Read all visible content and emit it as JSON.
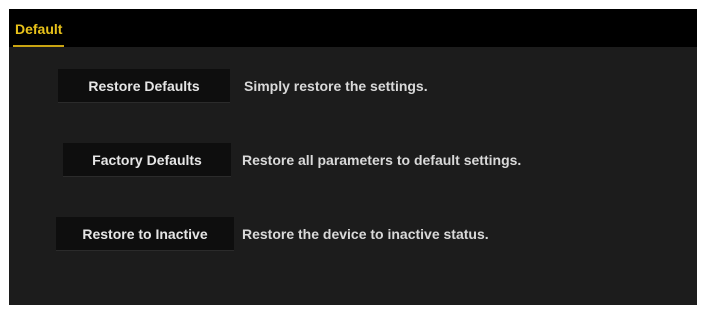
{
  "tabs": [
    {
      "label": "Default",
      "active": true
    }
  ],
  "rows": [
    {
      "button_label": "Restore Defaults",
      "description": "Simply restore the settings."
    },
    {
      "button_label": "Factory Defaults",
      "description": "Restore all parameters to default settings."
    },
    {
      "button_label": "Restore to Inactive",
      "description": "Restore the device to inactive status."
    }
  ],
  "colors": {
    "tab_accent": "#e8c21a",
    "panel_background": "#1c1c1c",
    "tabbar_background": "#000000",
    "button_background": "#0e0e0e"
  }
}
